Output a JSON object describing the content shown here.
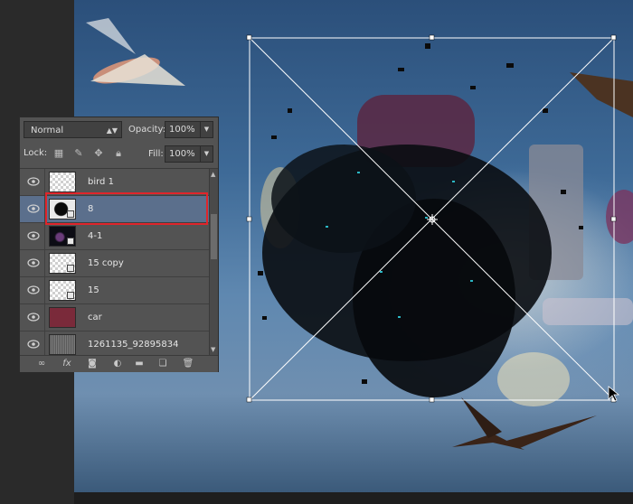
{
  "layers_panel": {
    "blend_mode": "Normal",
    "opacity_label": "Opacity:",
    "opacity_value": "100%",
    "lock_label": "Lock:",
    "fill_label": "Fill:",
    "fill_value": "100%",
    "layers": [
      {
        "name": "bird 1",
        "thumb": "transparent",
        "selected": false
      },
      {
        "name": "8",
        "thumb": "dark",
        "selected": true
      },
      {
        "name": "4-1",
        "thumb": "dark",
        "selected": false
      },
      {
        "name": "15 copy",
        "thumb": "transparent",
        "selected": false
      },
      {
        "name": "15",
        "thumb": "transparent",
        "selected": false
      },
      {
        "name": "car",
        "thumb": "transparent",
        "selected": false
      },
      {
        "name": "1261135_92895834",
        "thumb": "noise",
        "selected": false
      }
    ],
    "bottom_icons": [
      "link-icon",
      "fx-icon",
      "mask-icon",
      "adjustment-icon",
      "folder-icon",
      "new-layer-icon",
      "trash-icon"
    ]
  },
  "canvas": {
    "selection_color": "#e0252b",
    "accent_selected_row": "#5b6f8c"
  }
}
